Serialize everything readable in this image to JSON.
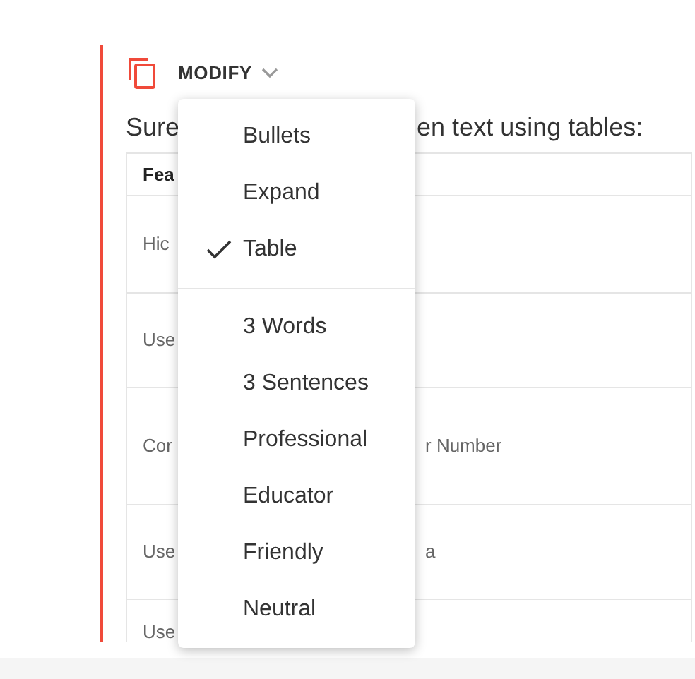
{
  "toolbar": {
    "menu_button": "MODIFY"
  },
  "intro_fragments": [
    "Sure",
    "en text using tables:"
  ],
  "table": {
    "header": [
      "Fea"
    ],
    "rows": [
      {
        "column_1": "Hic"
      },
      {
        "column_1": "Use"
      },
      {
        "column_1": "Cor",
        "column_2": "r Number"
      },
      {
        "column_1": "Use",
        "column_2": "a"
      },
      {
        "column_1": "Use"
      }
    ]
  },
  "menu": {
    "groups": [
      [
        {
          "label": "Bullets",
          "selected": false
        },
        {
          "label": "Expand",
          "selected": false
        },
        {
          "label": "Table",
          "selected": true
        }
      ],
      [
        {
          "label": "3 Words",
          "selected": false
        },
        {
          "label": "3 Sentences",
          "selected": false
        },
        {
          "label": "Professional",
          "selected": false
        },
        {
          "label": "Educator",
          "selected": false
        },
        {
          "label": "Friendly",
          "selected": false
        },
        {
          "label": "Neutral",
          "selected": false
        }
      ]
    ]
  }
}
